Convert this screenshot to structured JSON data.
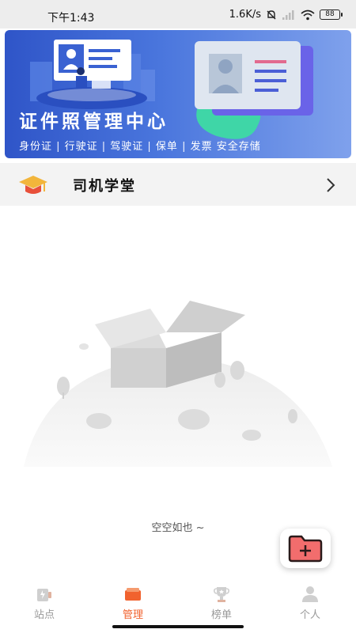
{
  "status_bar": {
    "time": "下午1:43",
    "network_speed": "1.6K/s",
    "battery": "88"
  },
  "banner": {
    "title": "证件照管理中心",
    "subtitle": "身份证 | 行驶证 | 驾驶证 | 保单 | 发票 安全存储"
  },
  "school_row": {
    "label": "司机学堂"
  },
  "empty_state": {
    "text": "空空如也 ~"
  },
  "tabs": [
    {
      "label": "站点",
      "icon": "station-icon",
      "active": false
    },
    {
      "label": "管理",
      "icon": "manage-icon",
      "active": true
    },
    {
      "label": "榜单",
      "icon": "trophy-icon",
      "active": false
    },
    {
      "label": "个人",
      "icon": "person-icon",
      "active": false
    }
  ],
  "colors": {
    "accent": "#f1622e",
    "banner_blue": "#3e66d6",
    "inactive_tab": "#999999"
  }
}
